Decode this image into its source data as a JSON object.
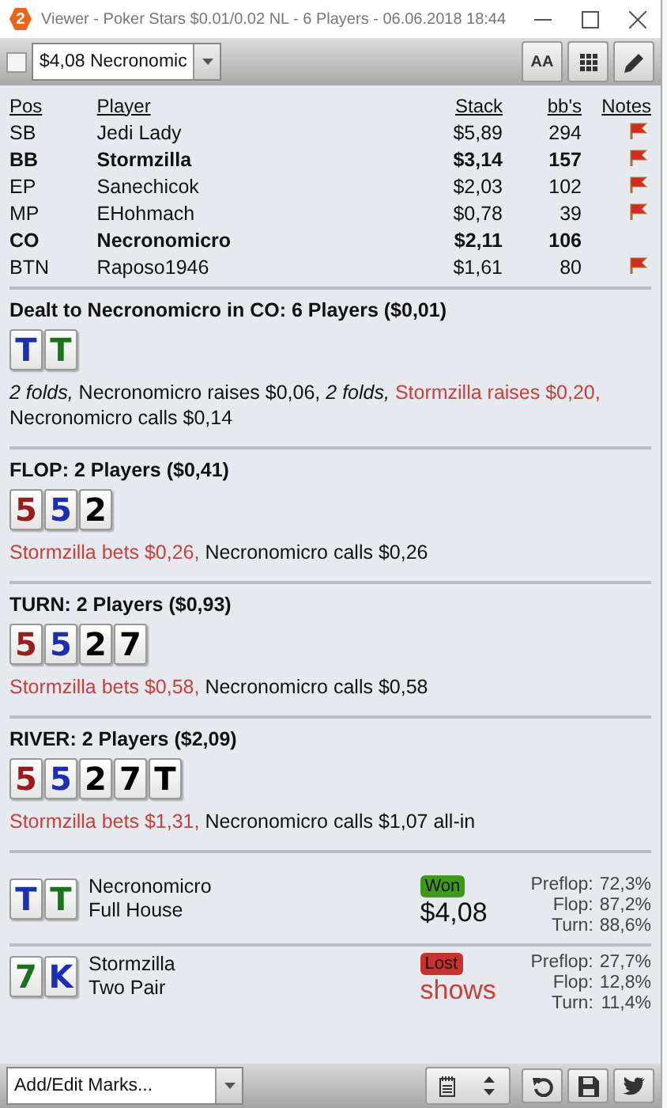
{
  "window": {
    "badge": "2",
    "title": "Viewer - Poker Stars $0.01/0.02 NL - 6 Players - 06.06.2018 18:44"
  },
  "toolbar": {
    "checkbox": {
      "checked": false
    },
    "hand_select": {
      "value": "$4,08 Necronomic"
    },
    "font_button": {
      "label": "AA"
    }
  },
  "players": {
    "columns": [
      "Pos",
      "Player",
      "Stack",
      "bb's",
      "Notes"
    ],
    "rows": [
      {
        "pos": "SB",
        "name": "Jedi Lady",
        "stack": "$5,89",
        "bbs": "294",
        "in_hand": false,
        "note": true
      },
      {
        "pos": "BB",
        "name": "Stormzilla",
        "stack": "$3,14",
        "bbs": "157",
        "in_hand": true,
        "note": true
      },
      {
        "pos": "EP",
        "name": "Sanechicok",
        "stack": "$2,03",
        "bbs": "102",
        "in_hand": false,
        "note": true
      },
      {
        "pos": "MP",
        "name": "EHohmach",
        "stack": "$0,78",
        "bbs": "39",
        "in_hand": false,
        "note": true
      },
      {
        "pos": "CO",
        "name": "Necronomicro",
        "stack": "$2,11",
        "bbs": "106",
        "in_hand": true,
        "note": false
      },
      {
        "pos": "BTN",
        "name": "Raposo1946",
        "stack": "$1,61",
        "bbs": "80",
        "in_hand": false,
        "note": true
      }
    ]
  },
  "streets": [
    {
      "title": "Dealt to Necronomicro in CO: 6 Players ($0,01)",
      "cards": [
        {
          "rank": "T",
          "color": "#1b2fb5"
        },
        {
          "rank": "T",
          "color": "#187418"
        }
      ],
      "actions": [
        {
          "text": "2 folds,",
          "kind": "fold"
        },
        {
          "text": "Necronomicro raises $0,06,",
          "kind": "hero"
        },
        {
          "text": "2 folds,",
          "kind": "fold"
        },
        {
          "text": "Stormzilla raises $0,20,",
          "kind": "villain"
        },
        {
          "text": "Necronomicro calls $0,14",
          "kind": "hero"
        }
      ]
    },
    {
      "title": "FLOP: 2 Players ($0,41)",
      "cards": [
        {
          "rank": "5",
          "color": "#9a1c1c"
        },
        {
          "rank": "5",
          "color": "#1b2fb5"
        },
        {
          "rank": "2",
          "color": "#000000"
        }
      ],
      "actions": [
        {
          "text": "Stormzilla bets $0,26,",
          "kind": "villain"
        },
        {
          "text": "Necronomicro calls $0,26",
          "kind": "hero"
        }
      ]
    },
    {
      "title": "TURN: 2 Players ($0,93)",
      "cards": [
        {
          "rank": "5",
          "color": "#9a1c1c"
        },
        {
          "rank": "5",
          "color": "#1b2fb5"
        },
        {
          "rank": "2",
          "color": "#000000"
        },
        {
          "rank": "7",
          "color": "#000000"
        }
      ],
      "actions": [
        {
          "text": "Stormzilla bets $0,58,",
          "kind": "villain"
        },
        {
          "text": "Necronomicro calls $0,58",
          "kind": "hero"
        }
      ]
    },
    {
      "title": "RIVER: 2 Players ($2,09)",
      "cards": [
        {
          "rank": "5",
          "color": "#9a1c1c"
        },
        {
          "rank": "5",
          "color": "#1b2fb5"
        },
        {
          "rank": "2",
          "color": "#000000"
        },
        {
          "rank": "7",
          "color": "#000000"
        },
        {
          "rank": "T",
          "color": "#000000"
        }
      ],
      "actions": [
        {
          "text": "Stormzilla bets $1,31,",
          "kind": "villain"
        },
        {
          "text": "Necronomicro calls $1,07 all-in",
          "kind": "hero"
        }
      ]
    }
  ],
  "results": [
    {
      "cards": [
        {
          "rank": "T",
          "color": "#1b2fb5"
        },
        {
          "rank": "T",
          "color": "#187418"
        }
      ],
      "name": "Necronomicro",
      "hand": "Full House",
      "outcome": {
        "kind": "won",
        "label": "Won"
      },
      "amount": "$4,08",
      "equity": [
        {
          "label": "Preflop:",
          "value": "72,3%"
        },
        {
          "label": "Flop:",
          "value": "87,2%"
        },
        {
          "label": "Turn:",
          "value": "88,6%"
        }
      ]
    },
    {
      "cards": [
        {
          "rank": "7",
          "color": "#187418"
        },
        {
          "rank": "K",
          "color": "#1b2fb5"
        }
      ],
      "name": "Stormzilla",
      "hand": "Two Pair",
      "outcome": {
        "kind": "lost",
        "label": "Lost"
      },
      "amount": "shows",
      "equity": [
        {
          "label": "Preflop:",
          "value": "27,7%"
        },
        {
          "label": "Flop:",
          "value": "12,8%"
        },
        {
          "label": "Turn:",
          "value": "11,4%"
        }
      ]
    }
  ],
  "footer": {
    "marks_select": {
      "value": "Add/Edit Marks..."
    }
  }
}
